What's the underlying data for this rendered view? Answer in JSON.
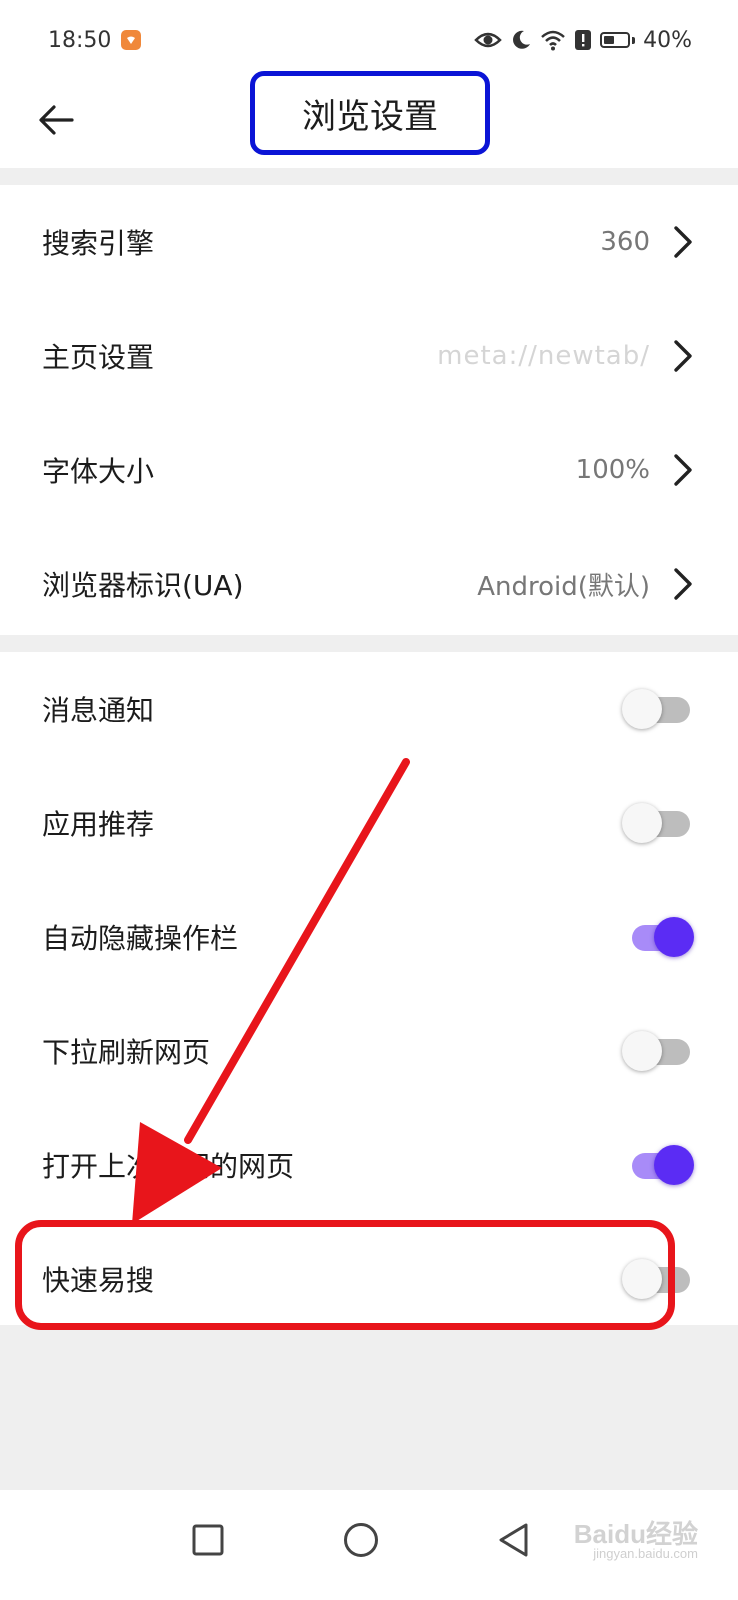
{
  "status_bar": {
    "time": "18:50",
    "battery": "40%",
    "icons": [
      "notification-app-icon",
      "eye-icon",
      "moon-icon",
      "wifi-icon",
      "alert-icon",
      "battery-icon"
    ]
  },
  "header": {
    "title": "浏览设置",
    "back_icon": "back-arrow-icon"
  },
  "browse_settings": [
    {
      "label": "搜索引擎",
      "value": "360"
    },
    {
      "label": "主页设置",
      "value": "meta://newtab/"
    },
    {
      "label": "字体大小",
      "value": "100%"
    },
    {
      "label": "浏览器标识(UA)",
      "value": "Android(默认)"
    }
  ],
  "toggle_settings": [
    {
      "label": "消息通知",
      "on": false
    },
    {
      "label": "应用推荐",
      "on": false
    },
    {
      "label": "自动隐藏操作栏",
      "on": true
    },
    {
      "label": "下拉刷新网页",
      "on": false
    },
    {
      "label": "打开上次关闭的网页",
      "on": true
    },
    {
      "label": "快速易搜",
      "on": false
    }
  ],
  "nav_bar": {
    "icons": [
      "recents-square-icon",
      "home-circle-icon",
      "back-triangle-icon"
    ]
  },
  "watermark": {
    "text": "Baidu经验",
    "sub": "jingyan.baidu.com"
  },
  "colors": {
    "toggle_on": "#5b2cf4",
    "toggle_on_track": "#a88bf8",
    "title_highlight": "#0b14d6",
    "annotation_red": "#e8151b"
  }
}
